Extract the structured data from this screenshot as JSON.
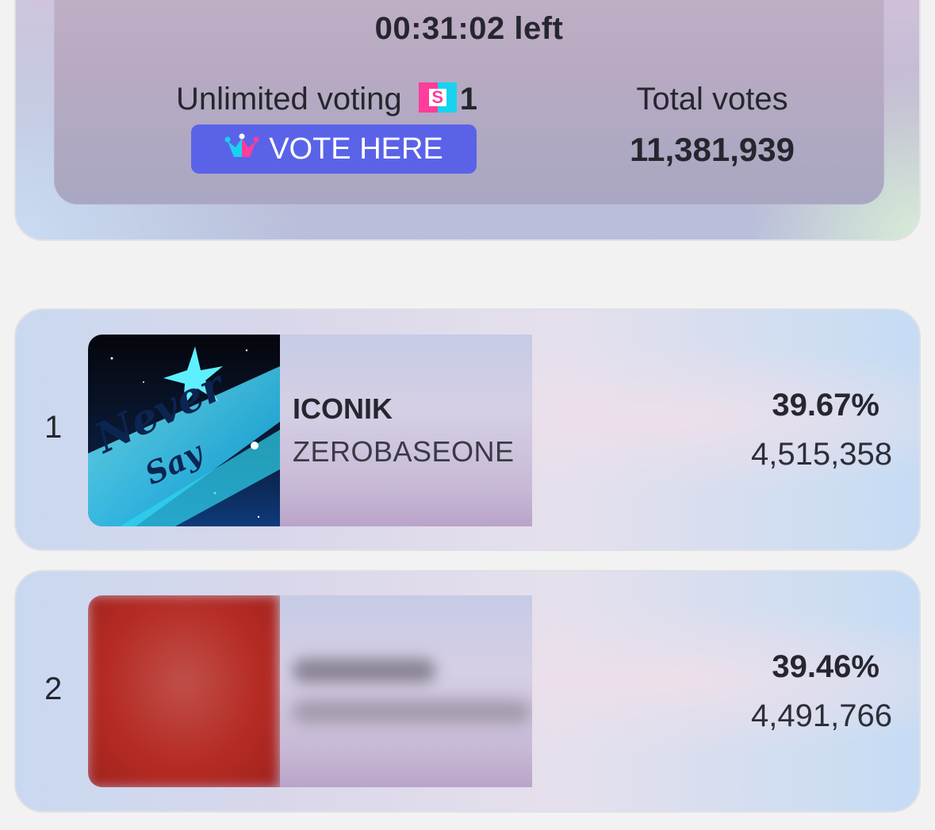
{
  "header": {
    "timer": "00:31:02 left",
    "unlimited_label": "Unlimited voting",
    "badge_glyph": "S",
    "badge_count": "1",
    "vote_button_label": "VOTE HERE",
    "total_votes_label": "Total votes",
    "total_votes_value": "11,381,939"
  },
  "rankings": [
    {
      "rank": "1",
      "title": "ICONIK",
      "artist": "ZEROBASEONE",
      "percent": "39.67%",
      "votes": "4,515,358",
      "art_icon": "album-cover-never-say-never"
    },
    {
      "rank": "2",
      "percent": "39.46%",
      "votes": "4,491,766",
      "art_icon": "album-cover-blurred"
    }
  ],
  "colors": {
    "vote_button": "#5a63e8",
    "badge_pink": "#ff3d9a",
    "badge_cyan": "#18d3f0"
  }
}
